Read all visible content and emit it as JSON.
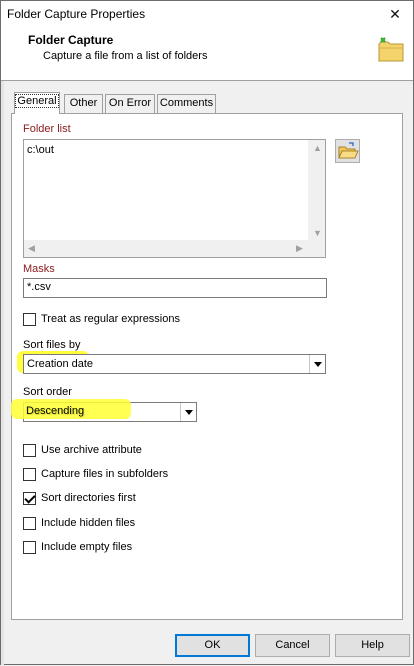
{
  "window": {
    "title": "Folder Capture Properties",
    "close_glyph": "✕"
  },
  "header": {
    "title": "Folder Capture",
    "subtitle": "Capture a file from a list of folders",
    "icon": "folder-icon"
  },
  "tabs": [
    {
      "label": "General",
      "active": true
    },
    {
      "label": "Other",
      "active": false
    },
    {
      "label": "On Error",
      "active": false
    },
    {
      "label": "Comments",
      "active": false
    }
  ],
  "general": {
    "folder_list_label": "Folder list",
    "folder_list_items": [
      "c:\\out"
    ],
    "masks_label": "Masks",
    "masks_value": "*.csv",
    "regex_label": "Treat as regular expressions",
    "regex_checked": false,
    "sort_by_label": "Sort files by",
    "sort_by_value": "Creation date",
    "sort_order_label": "Sort order",
    "sort_order_value": "Descending",
    "options": [
      {
        "label": "Use archive attribute",
        "checked": false
      },
      {
        "label": "Capture files in subfolders",
        "checked": false
      },
      {
        "label": "Sort directories first",
        "checked": true
      },
      {
        "label": "Include hidden files",
        "checked": false
      },
      {
        "label": "Include empty files",
        "checked": false
      }
    ]
  },
  "buttons": {
    "ok": "OK",
    "cancel": "Cancel",
    "help": "Help"
  },
  "colors": {
    "highlight": "#ffff33",
    "label_red": "#8b1a1a"
  }
}
